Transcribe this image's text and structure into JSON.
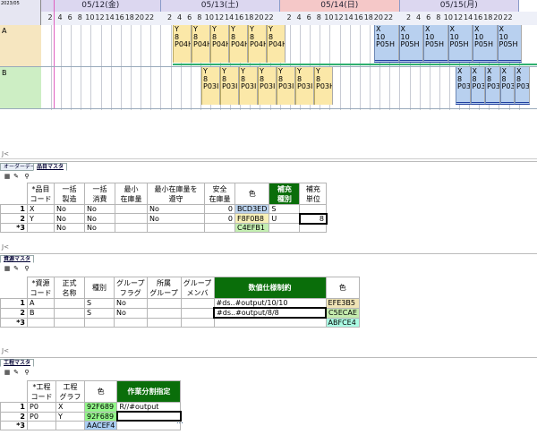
{
  "gantt": {
    "corner_label": "2023/05",
    "dates": [
      {
        "label": "05/12(金)",
        "color": "#dcd7f0"
      },
      {
        "label": "05/13(土)",
        "color": "#dcd7f0"
      },
      {
        "label": "05/14(日)",
        "color": "#f5c8c8"
      },
      {
        "label": "05/15(月)",
        "color": "#dcd7f0"
      }
    ],
    "hours": [
      "2",
      "4",
      "6",
      "8",
      "10",
      "12",
      "14",
      "16",
      "18",
      "20",
      "22"
    ],
    "rows": [
      {
        "label": "A",
        "label_color": "#f6e6c0",
        "tasks": [
          "Y\n8\nP04H",
          "Y\n8\nP04H",
          "Y\n8\nP04H",
          "Y\n8\nP04H",
          "Y\n8\nP04H",
          "Y\n8\nP04H",
          "X\n10\nP05H",
          "X\n10\nP05H",
          "X\n10\nP05H",
          "X\n10\nP05H",
          "X\n10\nP05H",
          "X\n10\nP05H"
        ]
      },
      {
        "label": "B",
        "label_color": "#cdeec4",
        "tasks": [
          "Y\n8\nP03I",
          "Y\n8\nP03I",
          "Y\n8\nP03I",
          "Y\n8\nP03I",
          "Y\n8\nP03I",
          "Y\n8\nP03I",
          "Y\n8\nP03H",
          "X\n8\nP03I",
          "X\n8\nP03I",
          "X\n8\nP03I",
          "X\n8\nP03I",
          "X\n8\nP03H"
        ]
      }
    ],
    "scroll_marker": "J<"
  },
  "panel1": {
    "tabs": [
      "オーダーデータ",
      "品目マスタ"
    ],
    "headers": [
      "*品目\nコード",
      "一括\n製造",
      "一括\n消費",
      "最小\n在庫量",
      "最小在庫量を\n遵守",
      "安全\n在庫量",
      "色",
      "補充\n種別",
      "補充\n単位"
    ],
    "rows": [
      {
        "n": "1",
        "cells": [
          "X",
          "No",
          "No",
          "",
          "No",
          "0",
          "BCD3ED",
          "S",
          ""
        ]
      },
      {
        "n": "2",
        "cells": [
          "Y",
          "No",
          "No",
          "",
          "No",
          "0",
          "F8F0B8",
          "U",
          "8"
        ]
      },
      {
        "n": "*3",
        "cells": [
          "",
          "No",
          "No",
          "",
          "",
          "",
          "C4EFB1",
          "",
          ""
        ]
      }
    ],
    "colors": [
      "#bcd3ed",
      "#f8f0b8",
      "#c4efb1"
    ]
  },
  "panel2": {
    "tabs": [
      "資源マスタ"
    ],
    "headers": [
      "*資源\nコード",
      "正式\n名称",
      "種別",
      "グループ\nフラグ",
      "所属\nグループ",
      "グループ\nメンバ",
      "数値仕様制約",
      "色"
    ],
    "rows": [
      {
        "n": "1",
        "cells": [
          "A",
          "",
          "S",
          "No",
          "",
          "",
          "#ds..#output/10/10",
          "EFE3B5"
        ]
      },
      {
        "n": "2",
        "cells": [
          "B",
          "",
          "S",
          "No",
          "",
          "",
          "#ds..#output/8/8",
          "C5ECAE"
        ]
      },
      {
        "n": "*3",
        "cells": [
          "",
          "",
          "",
          "",
          "",
          "",
          "",
          "ABFCE4"
        ]
      }
    ],
    "colors": [
      "#efe3b5",
      "#c5ecae",
      "#abfce4"
    ]
  },
  "panel3": {
    "tabs": [
      "工程マスタ"
    ],
    "headers": [
      "*工程\nコード",
      "工程\nグラフ",
      "色",
      "作業分割指定"
    ],
    "rows": [
      {
        "n": "1",
        "cells": [
          "P0",
          "X",
          "92F689",
          "R//#output"
        ]
      },
      {
        "n": "2",
        "cells": [
          "P0",
          "Y",
          "92F689",
          ""
        ]
      },
      {
        "n": "*3",
        "cells": [
          "",
          "",
          "AACEF4",
          ""
        ]
      }
    ],
    "colors": [
      "#92f689",
      "#92f689",
      "#aacef4"
    ],
    "ellipsis": "..."
  },
  "scroll_markers": [
    "J<",
    "J<"
  ]
}
